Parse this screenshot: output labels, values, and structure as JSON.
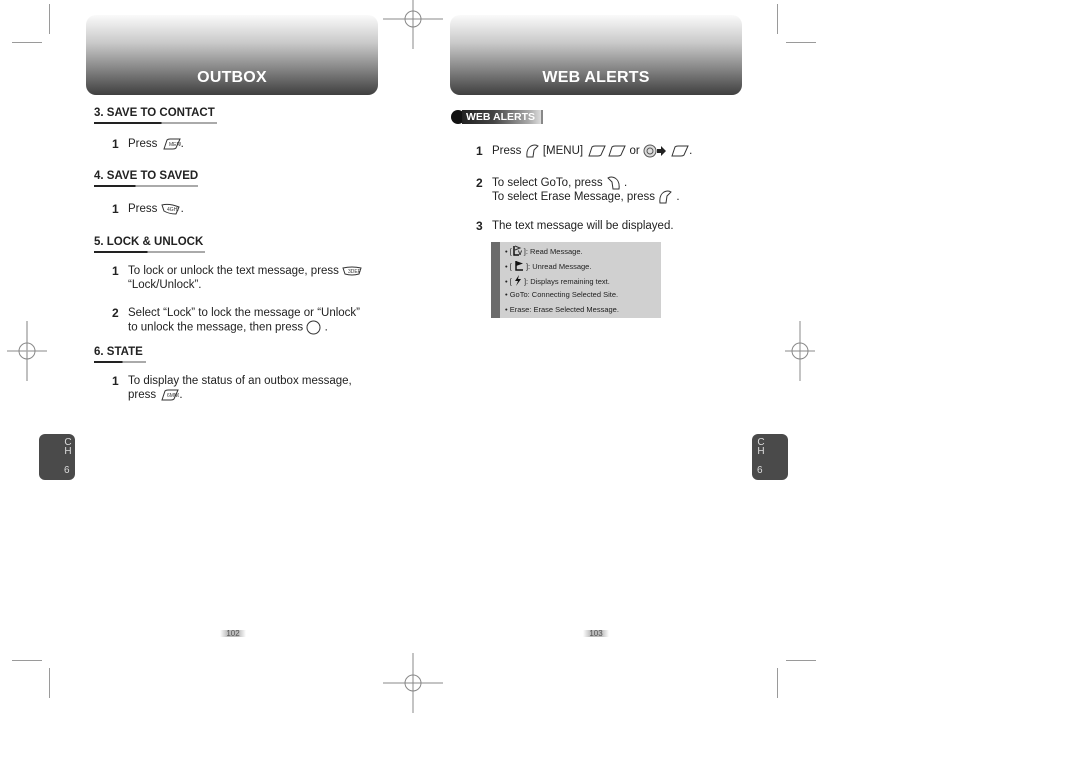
{
  "left_page": {
    "banner_title": "OUTBOX",
    "sections": [
      {
        "title": "3. SAVE TO CONTACT",
        "steps": [
          {
            "num": "1",
            "text": "Press",
            "key": "menu-key-icon",
            "suffix": "."
          }
        ]
      },
      {
        "title": "4. SAVE TO SAVED",
        "steps": [
          {
            "num": "1",
            "text": "Press",
            "key": "4ghi-key-icon",
            "suffix": "."
          }
        ]
      },
      {
        "title": "5. LOCK & UNLOCK",
        "steps": [
          {
            "num": "1",
            "line1": "To lock or unlock the text message, press",
            "key": "3def-key-icon",
            "line2": "“Lock/Unlock”."
          },
          {
            "num": "2",
            "line1": "Select “Lock” to lock the message or “Unlock”",
            "line2": "to unlock the message, then press",
            "key": "ok-key-icon",
            "suffix": "."
          }
        ]
      },
      {
        "title": "6. STATE",
        "steps": [
          {
            "num": "1",
            "line1": "To display the status of an outbox message,",
            "line2": "press",
            "key": "6mno-key-icon",
            "suffix": "."
          }
        ]
      }
    ],
    "chapter_tab": {
      "label": "CH",
      "number": "6"
    },
    "page_number": "102"
  },
  "right_page": {
    "banner_title": "WEB ALERTS",
    "subheading": "WEB ALERTS",
    "steps": [
      {
        "num": "1",
        "text_a": "Press",
        "text_b": "[MENU]",
        "text_c": "or",
        "suffix": "."
      },
      {
        "num": "2",
        "line1": "To select GoTo, press",
        "line2": "To select Erase Message, press",
        "suffix": "."
      },
      {
        "num": "3",
        "line1": "The text message will be displayed."
      }
    ],
    "notes": [
      {
        "icon": "read-message-icon",
        "text": "]: Read Message."
      },
      {
        "icon": "unread-message-icon",
        "text": " ]: Unread Message."
      },
      {
        "icon": "remaining-text-icon",
        "text": " ]: Displays remaining text."
      },
      {
        "icon": "",
        "text": "GoTo: Connecting Selected Site."
      },
      {
        "icon": "",
        "text": "Erase: Erase Selected Message."
      }
    ],
    "chapter_tab": {
      "label": "CH",
      "number": "6"
    },
    "page_number": "103"
  },
  "colors": {
    "banner_dark": "#3f3f3f",
    "tab": "#4a4a4a",
    "note_bg": "#d0d0d0",
    "note_bar": "#6b6b6b"
  }
}
